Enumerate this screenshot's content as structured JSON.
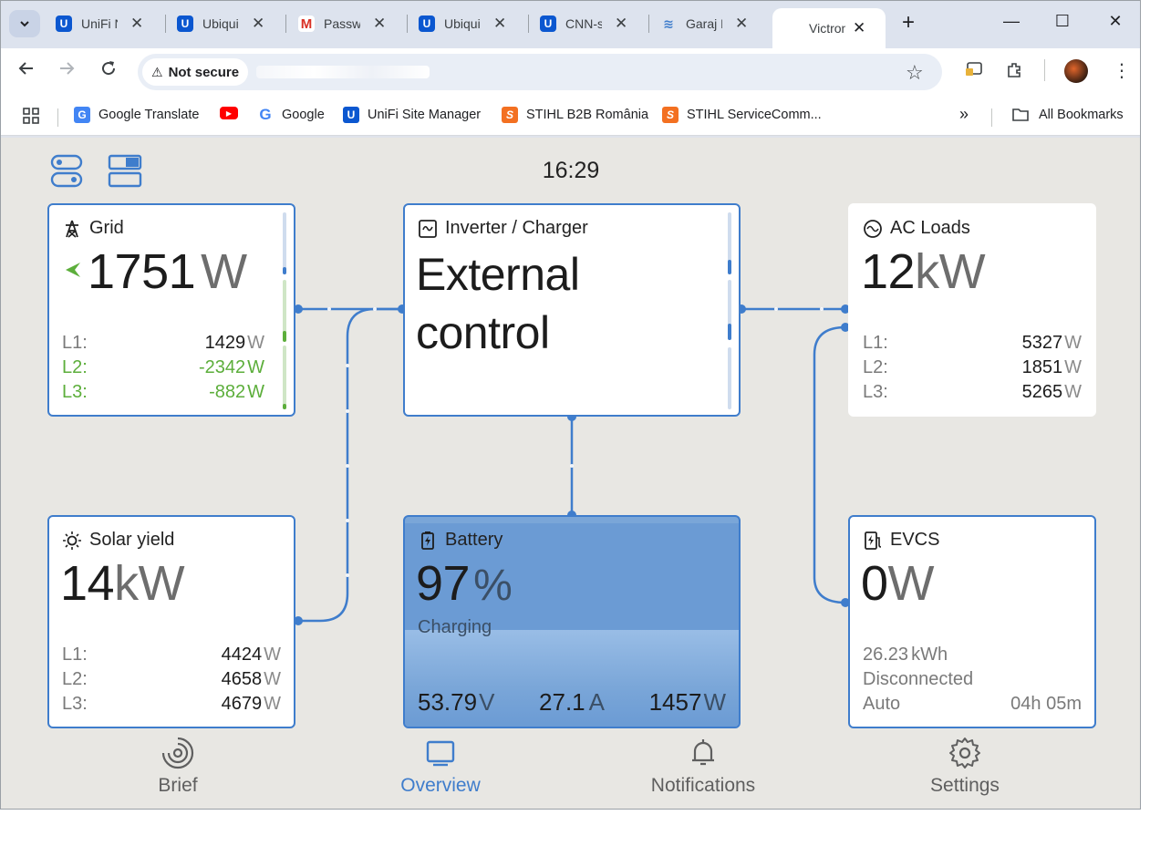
{
  "browser": {
    "tabs": [
      {
        "title": "UniFi N",
        "favicon": "unifi-icon"
      },
      {
        "title": "Ubiqui",
        "favicon": "unifi-icon"
      },
      {
        "title": "Passwo",
        "favicon": "gmail-icon"
      },
      {
        "title": "Ubiqui",
        "favicon": "unifi-icon"
      },
      {
        "title": "CNN-s",
        "favicon": "unifi-icon"
      },
      {
        "title": "Garaj N",
        "favicon": "victron-icon"
      },
      {
        "title": "Victron",
        "favicon": "none",
        "active": true
      }
    ],
    "security_label": "Not secure",
    "bookmarks": [
      {
        "label": "Google Translate",
        "icon": "google-translate-icon"
      },
      {
        "label": "",
        "icon": "youtube-icon"
      },
      {
        "label": "Google",
        "icon": "google-icon"
      },
      {
        "label": "UniFi Site Manager",
        "icon": "unifi-icon"
      },
      {
        "label": "STIHL B2B România",
        "icon": "stihl-icon"
      },
      {
        "label": "STIHL ServiceComm...",
        "icon": "stihl-icon"
      }
    ],
    "all_bookmarks_label": "All Bookmarks",
    "overflow_label": "»",
    "colors": {
      "tabstrip": "#dde3ee",
      "accent": "#0b57d0"
    }
  },
  "app": {
    "clock": "16:29",
    "accent_color": "#3f7dcc",
    "grid": {
      "title": "Grid",
      "value": "1751",
      "unit": "W",
      "direction_icon": "arrow-left-icon",
      "phases": [
        {
          "label": "L1:",
          "value": "1429",
          "unit": "W",
          "color": "default"
        },
        {
          "label": "L2:",
          "value": "-2342",
          "unit": "W",
          "color": "#5cae3b"
        },
        {
          "label": "L3:",
          "value": "-882",
          "unit": "W",
          "color": "#5cae3b"
        }
      ]
    },
    "inverter": {
      "title": "Inverter / Charger",
      "state_line1": "External",
      "state_line2": "control"
    },
    "ac_loads": {
      "title": "AC Loads",
      "value": "12",
      "unit": "kW",
      "phases": [
        {
          "label": "L1:",
          "value": "5327",
          "unit": "W"
        },
        {
          "label": "L2:",
          "value": "1851",
          "unit": "W"
        },
        {
          "label": "L3:",
          "value": "5265",
          "unit": "W"
        }
      ]
    },
    "solar": {
      "title": "Solar yield",
      "value": "14",
      "unit": "kW",
      "phases": [
        {
          "label": "L1:",
          "value": "4424",
          "unit": "W"
        },
        {
          "label": "L2:",
          "value": "4658",
          "unit": "W"
        },
        {
          "label": "L3:",
          "value": "4679",
          "unit": "W"
        }
      ]
    },
    "battery": {
      "title": "Battery",
      "soc": "97",
      "soc_unit": "%",
      "soc_fraction": 0.97,
      "state": "Charging",
      "voltage": "53.79",
      "voltage_unit": "V",
      "current": "27.1",
      "current_unit": "A",
      "power": "1457",
      "power_unit": "W"
    },
    "evcs": {
      "title": "EVCS",
      "value": "0",
      "unit": "W",
      "energy": "26.23",
      "energy_unit": "kWh",
      "status": "Disconnected",
      "mode": "Auto",
      "time": "04h 05m"
    },
    "nav": [
      {
        "label": "Brief",
        "icon": "brief-icon",
        "active": false
      },
      {
        "label": "Overview",
        "icon": "overview-icon",
        "active": true
      },
      {
        "label": "Notifications",
        "icon": "bell-icon",
        "active": false
      },
      {
        "label": "Settings",
        "icon": "gear-icon",
        "active": false
      }
    ]
  }
}
